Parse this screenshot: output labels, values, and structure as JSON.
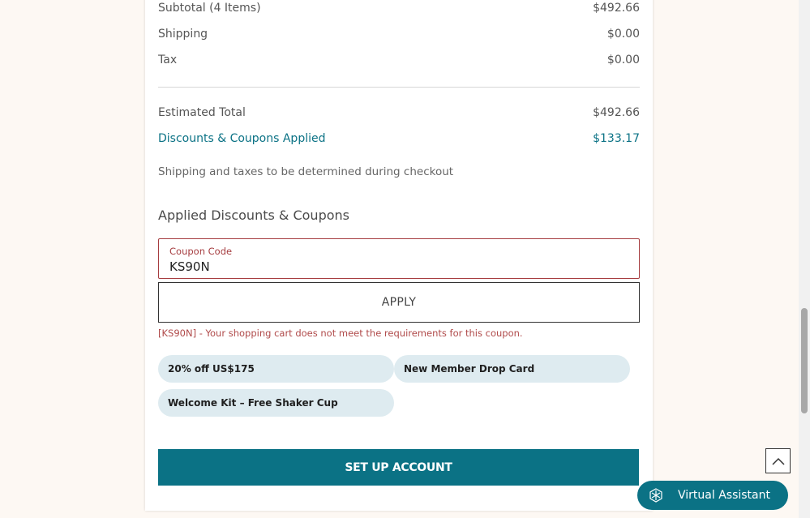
{
  "summary": {
    "subtotal_label": "Subtotal (4 Items)",
    "subtotal_value": "$492.66",
    "shipping_label": "Shipping",
    "shipping_value": "$0.00",
    "tax_label": "Tax",
    "tax_value": "$0.00",
    "estimated_label": "Estimated Total",
    "estimated_value": "$492.66",
    "discounts_label": "Discounts & Coupons Applied",
    "discounts_value": "$133.17",
    "note": "Shipping and taxes to be determined during checkout"
  },
  "coupons": {
    "section_title": "Applied Discounts & Coupons",
    "field_label": "Coupon Code",
    "field_value": "KS90N",
    "apply_label": "APPLY",
    "error_message": "[KS90N] - Your shopping cart does not meet the requirements for this coupon.",
    "chips": [
      "20% off US$175",
      "New Member Drop Card",
      "Welcome Kit – Free Shaker Cup"
    ]
  },
  "actions": {
    "setup_account_label": "SET UP ACCOUNT",
    "virtual_assistant_label": "Virtual Assistant"
  },
  "colors": {
    "accent": "#0b7285",
    "error": "#a63d40",
    "chip_bg": "#deebf0",
    "page_bg": "#fdf8f3"
  },
  "icons": {
    "scroll_top": "chevron-up-icon",
    "assistant": "snowflake-hex-icon"
  }
}
